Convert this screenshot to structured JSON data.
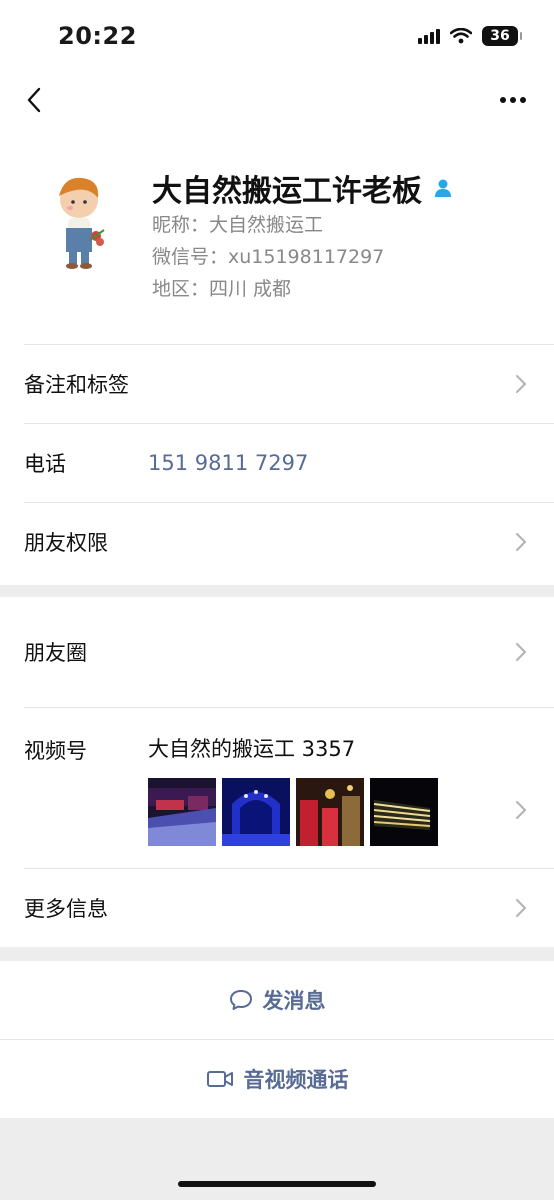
{
  "status_bar": {
    "time": "20:22",
    "battery": "36"
  },
  "profile": {
    "name": "大自然搬运工许老板",
    "nickname": "昵称：大自然搬运工",
    "wechat_id": "微信号：xu15198117297",
    "region": "地区：四川 成都"
  },
  "rows": {
    "notes_tags": "备注和标签",
    "phone_label": "电话",
    "phone_value": "151 9811 7297",
    "friend_permissions": "朋友权限",
    "moments": "朋友圈",
    "channels_label": "视频号",
    "channels_value": "大自然的搬运工 3357",
    "more_info": "更多信息"
  },
  "actions": {
    "send_message": "发消息",
    "av_call": "音视频通话"
  },
  "colors": {
    "link": "#576b95",
    "verified": "#2aa5e8",
    "background": "#ededed"
  },
  "icons": [
    "back-icon",
    "more-icon",
    "verified-icon",
    "chevron-right-icon",
    "chat-bubble-icon",
    "video-camera-icon"
  ]
}
